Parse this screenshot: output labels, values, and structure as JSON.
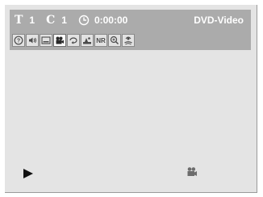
{
  "status": {
    "title_symbol": "T",
    "title_number": "1",
    "chapter_symbol": "C",
    "chapter_number": "1",
    "elapsed_time": "0:00:00",
    "disc_type": "DVD-Video"
  },
  "function_icons": [
    {
      "name": "help-icon",
      "state": "normal"
    },
    {
      "name": "audio-speaker-icon",
      "state": "normal"
    },
    {
      "name": "subtitle-icon",
      "state": "normal"
    },
    {
      "name": "camera-angle-icon",
      "state": "selected"
    },
    {
      "name": "repeat-icon",
      "state": "normal"
    },
    {
      "name": "picture-adjust-icon",
      "state": "normal"
    },
    {
      "name": "noise-reduction-icon",
      "state": "normal",
      "label": "NR"
    },
    {
      "name": "zoom-icon",
      "state": "normal"
    },
    {
      "name": "surround-sound-icon",
      "state": "normal"
    }
  ],
  "playback": {
    "state_icon": "play-icon"
  },
  "angle_indicator": {
    "icon": "camera-angle-icon"
  },
  "colors": {
    "background": "#e4e4e4",
    "osd_bar": "#ababab",
    "osd_text": "#ffffff",
    "icon_face": "#e2e2e2"
  }
}
